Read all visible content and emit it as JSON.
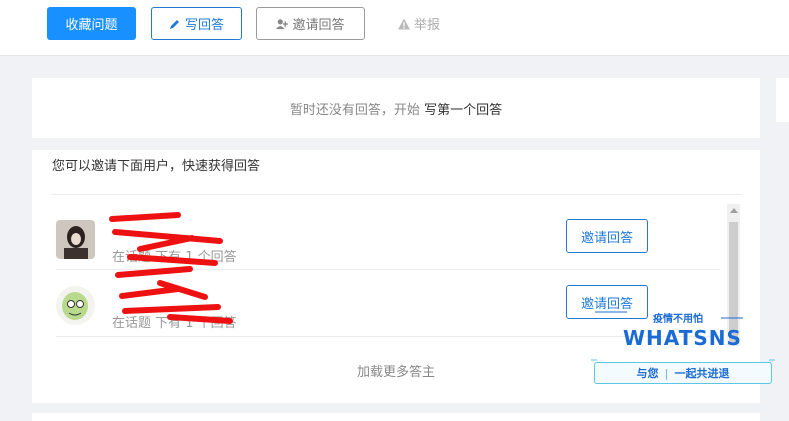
{
  "toolbar": {
    "favorite_label": "收藏问题",
    "write_answer_label": "写回答",
    "invite_answer_label": "邀请回答",
    "report_label": "举报"
  },
  "empty_state": {
    "message": "暂时还没有回答，开始",
    "link": "写第一个回答"
  },
  "invite": {
    "title": "您可以邀请下面用户，快速获得回答",
    "users": [
      {
        "name": "",
        "desc": "在话题 下有 1 个回答",
        "button": "邀请回答"
      },
      {
        "name": "",
        "desc": "在话题 下有 1 个回答",
        "button": "邀请回答"
      }
    ],
    "load_more": "加载更多答主"
  },
  "promo": {
    "tagline": "疫情不用怕",
    "brand": "WHATSNS",
    "slogan_left": "与您",
    "slogan_right": "一起共进退"
  },
  "colors": {
    "primary": "#1890ff",
    "link_blue": "#1f7ad6",
    "background": "#f1f2f5"
  }
}
